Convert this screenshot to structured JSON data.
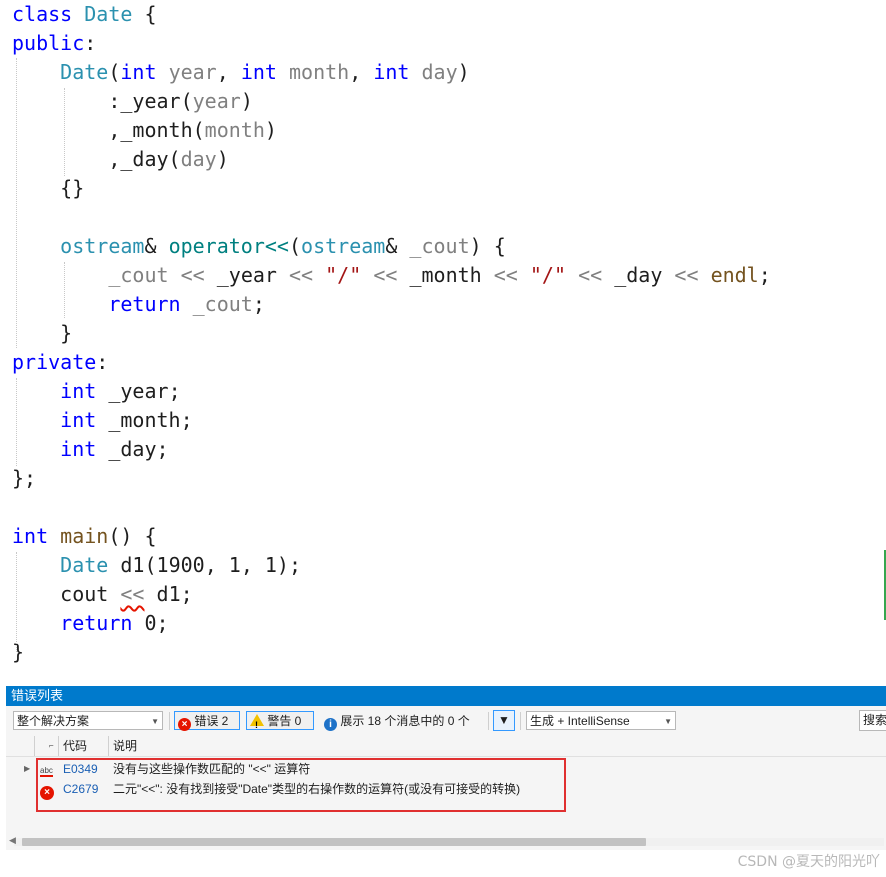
{
  "editor": {
    "lines": [
      {
        "t": [
          [
            "kw",
            "class"
          ],
          [
            "pl",
            " "
          ],
          [
            "cl",
            "Date"
          ],
          [
            "pl",
            " {"
          ]
        ]
      },
      {
        "t": [
          [
            "kw",
            "public"
          ],
          [
            "pl",
            ":"
          ]
        ]
      },
      {
        "t": [
          [
            "pl",
            "    "
          ],
          [
            "cl",
            "Date"
          ],
          [
            "pl",
            "("
          ],
          [
            "kw",
            "int"
          ],
          [
            "pl",
            " "
          ],
          [
            "pm",
            "year"
          ],
          [
            "pl",
            ", "
          ],
          [
            "kw",
            "int"
          ],
          [
            "pl",
            " "
          ],
          [
            "pm",
            "month"
          ],
          [
            "pl",
            ", "
          ],
          [
            "kw",
            "int"
          ],
          [
            "pl",
            " "
          ],
          [
            "pm",
            "day"
          ],
          [
            "pl",
            ")"
          ]
        ]
      },
      {
        "t": [
          [
            "pl",
            "        :"
          ],
          [
            "mb",
            "_year"
          ],
          [
            "pl",
            "("
          ],
          [
            "pm",
            "year"
          ],
          [
            "pl",
            ")"
          ]
        ]
      },
      {
        "t": [
          [
            "pl",
            "        ,"
          ],
          [
            "mb",
            "_month"
          ],
          [
            "pl",
            "("
          ],
          [
            "pm",
            "month"
          ],
          [
            "pl",
            ")"
          ]
        ]
      },
      {
        "t": [
          [
            "pl",
            "        ,"
          ],
          [
            "mb",
            "_day"
          ],
          [
            "pl",
            "("
          ],
          [
            "pm",
            "day"
          ],
          [
            "pl",
            ")"
          ]
        ]
      },
      {
        "t": [
          [
            "pl",
            "    {}"
          ]
        ]
      },
      {
        "t": [
          [
            "pl",
            ""
          ]
        ]
      },
      {
        "t": [
          [
            "pl",
            "    "
          ],
          [
            "ty",
            "ostream"
          ],
          [
            "pl",
            "& "
          ],
          [
            "op",
            "operator<<"
          ],
          [
            "pl",
            "("
          ],
          [
            "ty",
            "ostream"
          ],
          [
            "pl",
            "& "
          ],
          [
            "pm",
            "_cout"
          ],
          [
            "pl",
            ") {"
          ]
        ]
      },
      {
        "t": [
          [
            "pl",
            "        "
          ],
          [
            "pm",
            "_cout"
          ],
          [
            "pl",
            " "
          ],
          [
            "pm",
            "<<"
          ],
          [
            "pl",
            " "
          ],
          [
            "mb",
            "_year"
          ],
          [
            "pl",
            " "
          ],
          [
            "pm",
            "<<"
          ],
          [
            "pl",
            " "
          ],
          [
            "st",
            "\"/\""
          ],
          [
            "pl",
            " "
          ],
          [
            "pm",
            "<<"
          ],
          [
            "pl",
            " "
          ],
          [
            "mb",
            "_month"
          ],
          [
            "pl",
            " "
          ],
          [
            "pm",
            "<<"
          ],
          [
            "pl",
            " "
          ],
          [
            "st",
            "\"/\""
          ],
          [
            "pl",
            " "
          ],
          [
            "pm",
            "<<"
          ],
          [
            "pl",
            " "
          ],
          [
            "mb",
            "_day"
          ],
          [
            "pl",
            " "
          ],
          [
            "pm",
            "<<"
          ],
          [
            "pl",
            " "
          ],
          [
            "fn",
            "endl"
          ],
          [
            "pl",
            ";"
          ]
        ]
      },
      {
        "t": [
          [
            "pl",
            "        "
          ],
          [
            "kw",
            "return"
          ],
          [
            "pl",
            " "
          ],
          [
            "pm",
            "_cout"
          ],
          [
            "pl",
            ";"
          ]
        ]
      },
      {
        "t": [
          [
            "pl",
            "    }"
          ]
        ]
      },
      {
        "t": [
          [
            "kw",
            "private"
          ],
          [
            "pl",
            ":"
          ]
        ]
      },
      {
        "t": [
          [
            "pl",
            "    "
          ],
          [
            "kw",
            "int"
          ],
          [
            "pl",
            " "
          ],
          [
            "mb",
            "_year"
          ],
          [
            "pl",
            ";"
          ]
        ]
      },
      {
        "t": [
          [
            "pl",
            "    "
          ],
          [
            "kw",
            "int"
          ],
          [
            "pl",
            " "
          ],
          [
            "mb",
            "_month"
          ],
          [
            "pl",
            ";"
          ]
        ]
      },
      {
        "t": [
          [
            "pl",
            "    "
          ],
          [
            "kw",
            "int"
          ],
          [
            "pl",
            " "
          ],
          [
            "mb",
            "_day"
          ],
          [
            "pl",
            ";"
          ]
        ]
      },
      {
        "t": [
          [
            "pl",
            "};"
          ]
        ]
      },
      {
        "t": [
          [
            "pl",
            ""
          ]
        ]
      },
      {
        "t": [
          [
            "kw",
            "int"
          ],
          [
            "pl",
            " "
          ],
          [
            "fn",
            "main"
          ],
          [
            "pl",
            "() {"
          ]
        ]
      },
      {
        "t": [
          [
            "pl",
            "    "
          ],
          [
            "cl",
            "Date"
          ],
          [
            "pl",
            " "
          ],
          [
            "mb",
            "d1"
          ],
          [
            "pl",
            "(1900, 1, 1);"
          ]
        ]
      },
      {
        "t": [
          [
            "pl",
            "    "
          ],
          [
            "mb",
            "cout"
          ],
          [
            "pl",
            " "
          ],
          [
            "sq",
            "<<"
          ],
          [
            "pl",
            " "
          ],
          [
            "mb",
            "d1"
          ],
          [
            "pl",
            ";"
          ]
        ]
      },
      {
        "t": [
          [
            "pl",
            "    "
          ],
          [
            "kw",
            "return"
          ],
          [
            "pl",
            " 0;"
          ]
        ]
      },
      {
        "t": [
          [
            "pl",
            "}"
          ]
        ]
      }
    ]
  },
  "error_list": {
    "title": "错误列表",
    "scope_dropdown": "整个解决方案",
    "errors_toggle": "错误 2",
    "warnings_toggle": "警告 0",
    "messages_toggle": "展示 18 个消息中的 0 个",
    "build_dropdown": "生成 + IntelliSense",
    "search_placeholder": "搜索",
    "columns": {
      "code": "代码",
      "description": "说明"
    },
    "rows": [
      {
        "code": "E0349",
        "description": "没有与这些操作数匹配的 \"<<\" 运算符",
        "icon": "spell-check-icon"
      },
      {
        "code": "C2679",
        "description": "二元\"<<\": 没有找到接受\"Date\"类型的右操作数的运算符(或没有可接受的转换)",
        "icon": "error-icon"
      }
    ],
    "spell_icon_text": "abc",
    "accent": "#007acc",
    "error_color": "#e51400"
  },
  "watermark": "CSDN @夏天的阳光吖"
}
